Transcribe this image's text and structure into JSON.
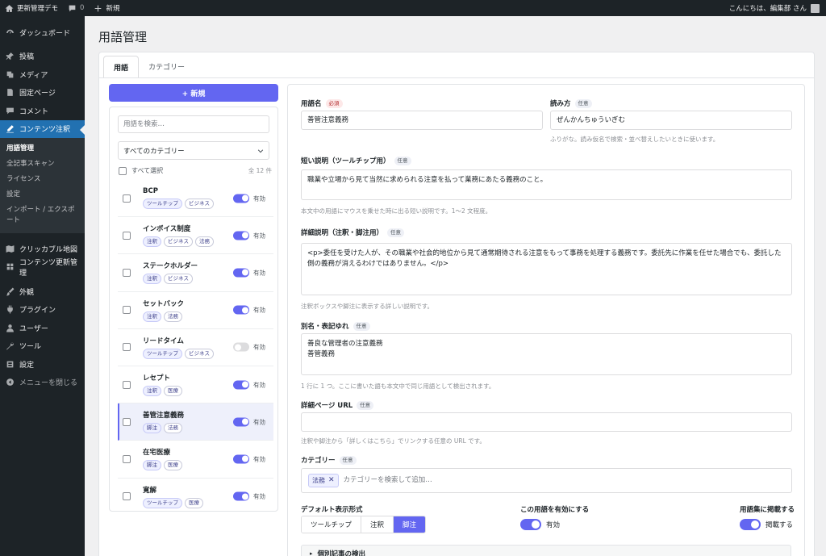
{
  "adminbar": {
    "site_name": "更新管理デモ",
    "comments_count": "0",
    "new_label": "新規",
    "greeting": "こんにちは、編集部 さん"
  },
  "sidebar": {
    "items_top": [
      {
        "label": "ダッシュボード",
        "icon": "dashboard-icon"
      },
      {
        "label": "投稿",
        "icon": "pin-icon"
      },
      {
        "label": "メディア",
        "icon": "media-icon"
      },
      {
        "label": "固定ページ",
        "icon": "page-icon"
      },
      {
        "label": "コメント",
        "icon": "comment-icon"
      },
      {
        "label": "コンテンツ注釈",
        "icon": "edit-icon"
      }
    ],
    "submenu": [
      "用語管理",
      "全記事スキャン",
      "ライセンス",
      "設定",
      "インポート / エクスポート"
    ],
    "items_mid": [
      {
        "label": "クリッカブル地図",
        "icon": "map-icon"
      },
      {
        "label": "コンテンツ更新管理",
        "icon": "update-icon"
      }
    ],
    "items_bottom": [
      {
        "label": "外観",
        "icon": "brush-icon"
      },
      {
        "label": "プラグイン",
        "icon": "plugin-icon"
      },
      {
        "label": "ユーザー",
        "icon": "user-icon"
      },
      {
        "label": "ツール",
        "icon": "wrench-icon"
      },
      {
        "label": "設定",
        "icon": "settings-icon"
      }
    ],
    "collapse_label": "メニューを閉じる"
  },
  "page": {
    "title": "用語管理",
    "tabs": [
      "用語",
      "カテゴリー"
    ]
  },
  "list": {
    "new_button": "+ 新規",
    "search_placeholder": "用語を検索…",
    "category_filter": "すべてのカテゴリー",
    "select_all": "すべて選択",
    "count": "全 12 件",
    "enabled_label": "有効",
    "terms": [
      {
        "name": "BCP",
        "tags": [
          "ツールチップ",
          "ビジネス"
        ],
        "enabled": true,
        "selected": false
      },
      {
        "name": "インボイス制度",
        "tags": [
          "注釈",
          "ビジネス",
          "法務"
        ],
        "enabled": true,
        "selected": false
      },
      {
        "name": "ステークホルダー",
        "tags": [
          "注釈",
          "ビジネス"
        ],
        "enabled": true,
        "selected": false
      },
      {
        "name": "セットバック",
        "tags": [
          "注釈",
          "法務"
        ],
        "enabled": true,
        "selected": false
      },
      {
        "name": "リードタイム",
        "tags": [
          "ツールチップ",
          "ビジネス"
        ],
        "enabled": false,
        "selected": false
      },
      {
        "name": "レセプト",
        "tags": [
          "注釈",
          "医療"
        ],
        "enabled": true,
        "selected": false
      },
      {
        "name": "善管注意義務",
        "tags": [
          "脚注",
          "法務"
        ],
        "enabled": true,
        "selected": true
      },
      {
        "name": "在宅医療",
        "tags": [
          "脚注",
          "医療"
        ],
        "enabled": true,
        "selected": false
      },
      {
        "name": "寛解",
        "tags": [
          "ツールチップ",
          "医療"
        ],
        "enabled": true,
        "selected": false
      }
    ]
  },
  "form": {
    "name_label": "用語名",
    "required_badge": "必須",
    "optional_badge": "任意",
    "name_value": "善管注意義務",
    "reading_label": "読み方",
    "reading_value": "ぜんかんちゅういぎむ",
    "reading_help": "ふりがな。読み仮名で検索・並べ替えしたいときに使います。",
    "short_label": "短い説明（ツールチップ用）",
    "short_value": "職業や立場から見て当然に求められる注意を払って業務にあたる義務のこと。",
    "short_help": "本文中の用語にマウスを乗せた時に出る短い説明です。1〜2 文程度。",
    "detail_label": "詳細説明（注釈・脚注用）",
    "detail_value": "<p>委任を受けた人が、その職業や社会的地位から見て通常期待される注意をもって事務を処理する義務です。委託先に作業を任せた場合でも、委託した側の義務が消えるわけではありません。</p>",
    "detail_help": "注釈ボックスや脚注に表示する詳しい説明です。",
    "alias_label": "別名・表記ゆれ",
    "alias_value": "善良な管理者の注意義務\n善管義務",
    "alias_help": "1 行に 1 つ。ここに書いた語も本文中で同じ用語として検出されます。",
    "url_label": "詳細ページ URL",
    "url_value": "",
    "url_help": "注釈や脚注から「詳しくはこちら」でリンクする任意の URL です。",
    "category_label": "カテゴリー",
    "category_chip": "法務",
    "category_placeholder": "カテゴリーを検索して追加…",
    "display_label": "デフォルト表示形式",
    "display_options": [
      "ツールチップ",
      "注釈",
      "脚注"
    ],
    "display_selected": "脚注",
    "enable_label": "この用語を有効にする",
    "enable_value": "有効",
    "glossary_label": "用語集に掲載する",
    "glossary_value": "掲載する",
    "accordion_label": "個別記事の検出"
  },
  "colors": {
    "accent": "#6366f1",
    "admin_dark": "#1d2327",
    "wp_blue": "#2271b1"
  }
}
